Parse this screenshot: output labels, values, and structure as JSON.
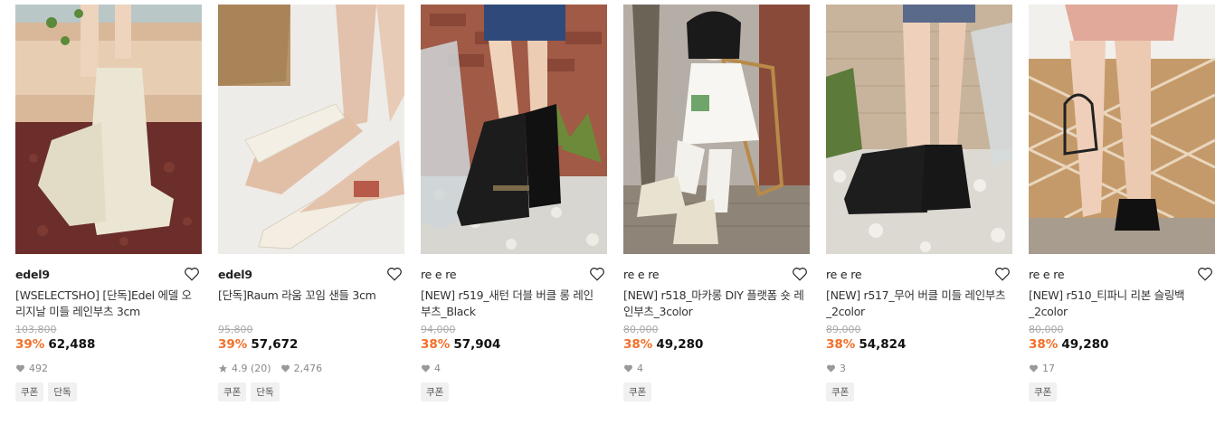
{
  "products": [
    {
      "brand": "edel9",
      "title": "[WSELECTSHO] [단독]Edel 에델 오리지날 미들 레인부츠 3cm",
      "original_price": "103,800",
      "discount": "39%",
      "price": "62,488",
      "rating": "",
      "likes": "492",
      "tags": [
        "쿠폰",
        "단독"
      ]
    },
    {
      "brand": "edel9",
      "title": "[단독]Raum 라움 꼬임 샌들 3cm",
      "original_price": "95,800",
      "discount": "39%",
      "price": "57,672",
      "rating": "4.9 (20)",
      "likes": "2,476",
      "tags": [
        "쿠폰",
        "단독"
      ]
    },
    {
      "brand": "re e re",
      "title": "[NEW] r519_새턴 더블 버클 롱 레인부츠_Black",
      "original_price": "94,000",
      "discount": "38%",
      "price": "57,904",
      "rating": "",
      "likes": "4",
      "tags": [
        "쿠폰"
      ]
    },
    {
      "brand": "re e re",
      "title": "[NEW] r518_마카롱 DIY 플랫폼 숏 레인부츠_3color",
      "original_price": "80,000",
      "discount": "38%",
      "price": "49,280",
      "rating": "",
      "likes": "4",
      "tags": [
        "쿠폰"
      ]
    },
    {
      "brand": "re e re",
      "title": "[NEW] r517_무어 버클 미들 레인부츠 _2color",
      "original_price": "89,000",
      "discount": "38%",
      "price": "54,824",
      "rating": "",
      "likes": "3",
      "tags": [
        "쿠폰"
      ]
    },
    {
      "brand": "re e re",
      "title": "[NEW] r510_티파니 리본 슬링백 _2color",
      "original_price": "80,000",
      "discount": "38%",
      "price": "49,280",
      "rating": "",
      "likes": "17",
      "tags": [
        "쿠폰"
      ]
    }
  ],
  "colors": {
    "discount": "#f2702a",
    "strike": "#aaaaaa",
    "tag_bg": "#f1f1f1"
  }
}
